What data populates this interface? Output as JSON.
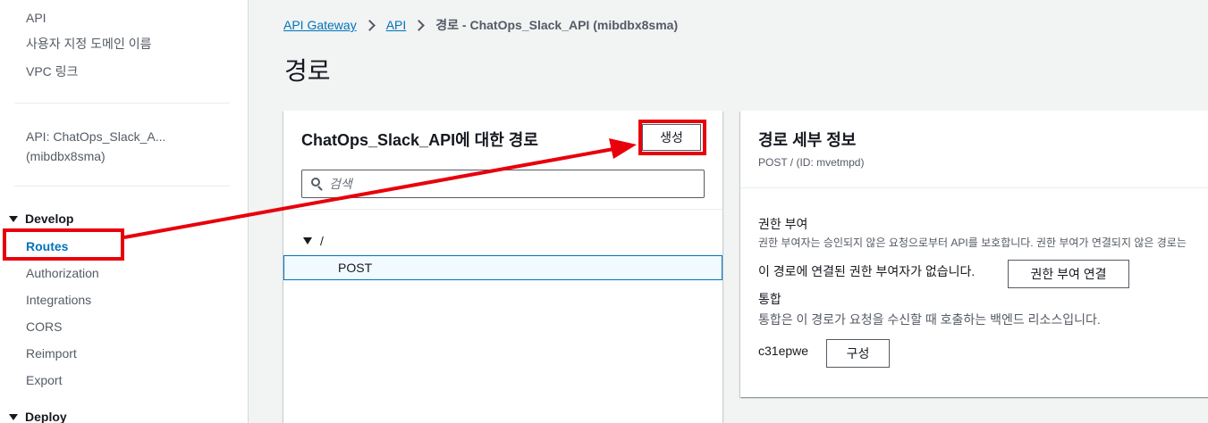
{
  "sidebar": {
    "top_items": [
      "API",
      "사용자 지정 도메인 이름",
      "VPC 링크"
    ],
    "api_name": "API: ChatOps_Slack_A...",
    "api_id": "(mibdbx8sma)",
    "develop_label": "Develop",
    "develop_items": [
      "Routes",
      "Authorization",
      "Integrations",
      "CORS",
      "Reimport",
      "Export"
    ],
    "active_item": "Routes",
    "deploy_label": "Deploy"
  },
  "breadcrumb": {
    "items": [
      "API Gateway",
      "API"
    ],
    "current": "경로 - ChatOps_Slack_API (mibdbx8sma)"
  },
  "page_title": "경로",
  "routes_panel": {
    "title": "ChatOps_Slack_API에 대한 경로",
    "create_label": "생성",
    "search_placeholder": "검색",
    "root_path": "/",
    "selected_method": "POST"
  },
  "details_panel": {
    "title": "경로 세부 정보",
    "subtitle": "POST / (ID: mvetmpd)",
    "auth_heading": "권한 부여",
    "auth_description": "권한 부여자는 승인되지 않은 요청으로부터 API를 보호합니다. 권한 부여가 연결되지 않은 경로는",
    "auth_status": "이 경로에 연결된 권한 부여자가 없습니다.",
    "attach_auth_label": "권한 부여 연결",
    "integration_heading": "통합",
    "integration_description": "통합은 이 경로가 요청을 수신할 때 호출하는 백엔드 리소스입니다.",
    "integration_id": "c31epwe",
    "configure_label": "구성"
  },
  "colors": {
    "link": "#0073bb",
    "annotation": "#e8000b",
    "background": "#f2f3f3"
  }
}
